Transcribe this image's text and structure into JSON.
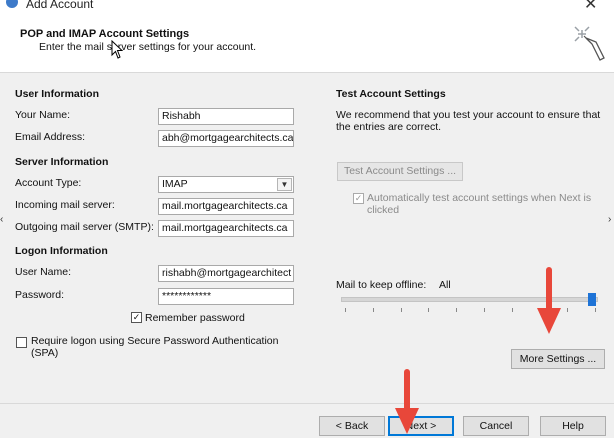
{
  "window": {
    "title": "Add Account"
  },
  "header": {
    "title": "POP and IMAP Account Settings",
    "subtitle": "Enter the mail server settings for your account."
  },
  "user_info": {
    "heading": "User Information",
    "name_label": "Your Name:",
    "name_value": "Rishabh",
    "email_label": "Email Address:",
    "email_value": "abh@mortgagearchitects.ca"
  },
  "server_info": {
    "heading": "Server Information",
    "account_type_label": "Account Type:",
    "account_type_value": "IMAP",
    "incoming_label": "Incoming mail server:",
    "incoming_value": "mail.mortgagearchitects.ca",
    "outgoing_label": "Outgoing mail server (SMTP):",
    "outgoing_value": "mail.mortgagearchitects.ca"
  },
  "logon_info": {
    "heading": "Logon Information",
    "username_label": "User Name:",
    "username_value": "rishabh@mortgagearchitect",
    "password_label": "Password:",
    "password_value": "************",
    "remember_label": "Remember password",
    "remember_checked": true,
    "spa_label": "Require logon using Secure Password Authentication (SPA)",
    "spa_checked": false
  },
  "test_account": {
    "heading": "Test Account Settings",
    "description": "We recommend that you test your account to ensure that the entries are correct.",
    "test_button": "Test Account Settings ...",
    "auto_test_label": "Automatically test account settings when Next is clicked",
    "auto_test_checked": true
  },
  "offline": {
    "label": "Mail to keep offline:",
    "value": "All",
    "slider_level": 1.0
  },
  "buttons": {
    "more_settings": "More Settings ...",
    "back": "< Back",
    "next": "Next >",
    "cancel": "Cancel",
    "help": "Help"
  },
  "colors": {
    "accent": "#0078d7",
    "annotation_arrow": "#e8473a"
  }
}
